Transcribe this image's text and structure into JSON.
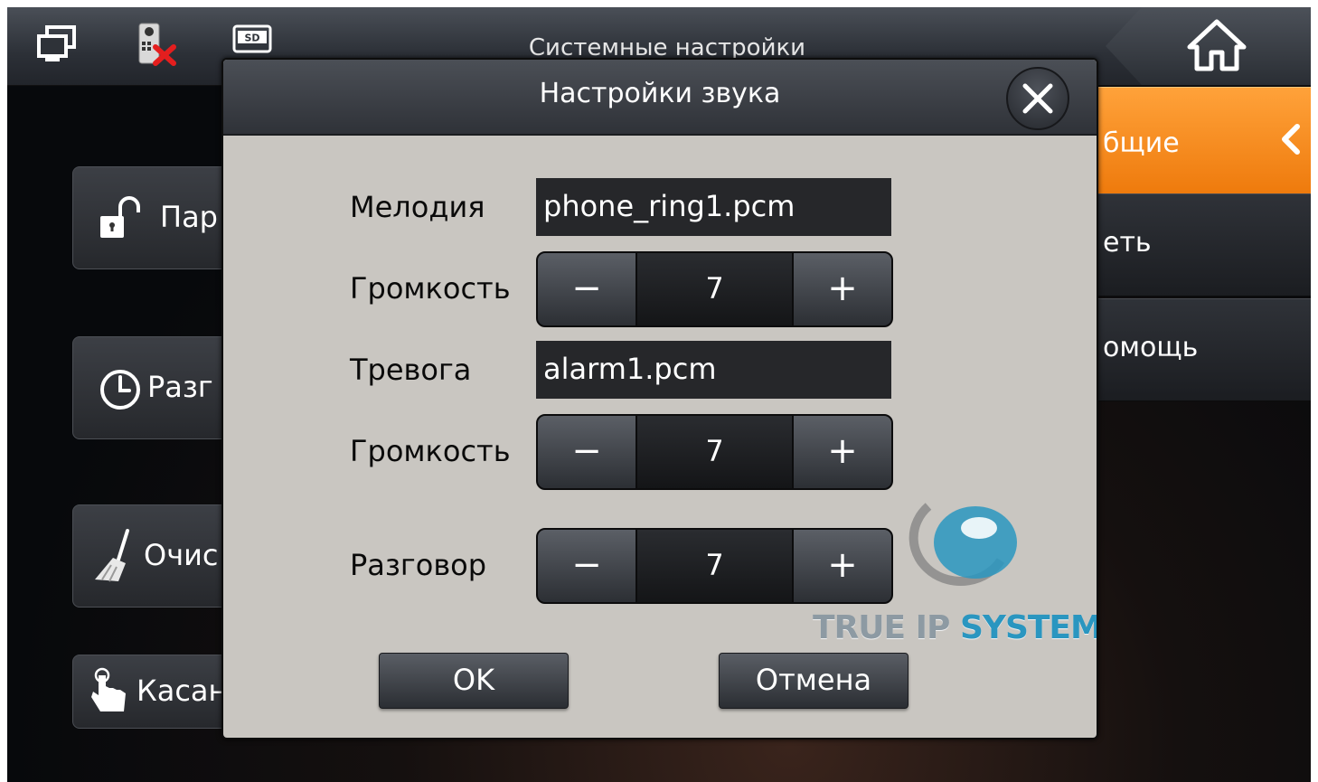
{
  "topbar": {
    "title": "Системные настройки",
    "icons": [
      "monitor-icon",
      "door-station-disconnected-icon",
      "sd-card-icon",
      "home-icon"
    ],
    "sd_label": "SD"
  },
  "right_menu": {
    "items": [
      {
        "label": "бщие",
        "active": true
      },
      {
        "label": "еть",
        "active": false
      },
      {
        "label": "омощь",
        "active": false
      }
    ]
  },
  "left_buttons": [
    {
      "label": "Пар",
      "icon": "unlock-icon"
    },
    {
      "label": "Разг",
      "icon": "clock-icon"
    },
    {
      "label": "Очис",
      "icon": "broom-icon"
    },
    {
      "label": "Касан",
      "icon": "touch-icon"
    }
  ],
  "dialog": {
    "title": "Настройки звука",
    "ringtone": {
      "label": "Мелодия",
      "value": "phone_ring1.pcm"
    },
    "ring_volume": {
      "label": "Громкость",
      "value": "7",
      "minus": "−",
      "plus": "+"
    },
    "alarm": {
      "label": "Тревога",
      "value": "alarm1.pcm"
    },
    "alarm_volume": {
      "label": "Громкость",
      "value": "7",
      "minus": "−",
      "plus": "+"
    },
    "talk_volume": {
      "label": "Разговор",
      "value": "7",
      "minus": "−",
      "plus": "+"
    },
    "ok_label": "OK",
    "cancel_label": "Отмена"
  },
  "watermark": {
    "part1": "TRUE IP ",
    "part2": "SYSTEMS"
  },
  "colors": {
    "accent": "#f08414",
    "dialog_bg": "#c9c6c1",
    "field_bg": "#26272a"
  }
}
